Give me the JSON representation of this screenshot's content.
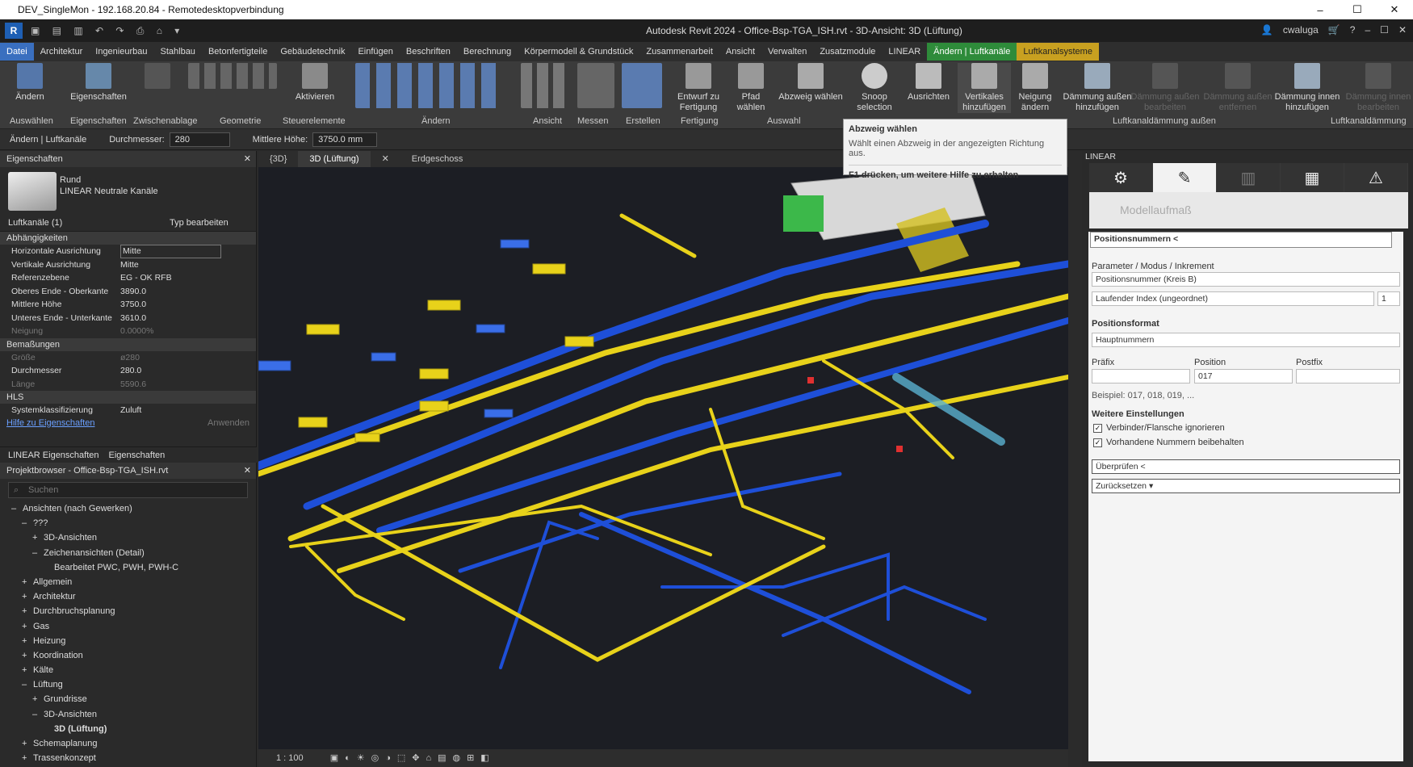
{
  "rdp": {
    "title": "DEV_SingleMon - 192.168.20.84 - Remotedesktopverbindung",
    "min": "–",
    "max": "☐",
    "close": "✕"
  },
  "title": {
    "text": "Autodesk Revit 2024 - Office-Bsp-TGA_ISH.rvt - 3D-Ansicht: 3D (Lüftung)",
    "user": "cwaluga"
  },
  "tabs": [
    "Datei",
    "Architektur",
    "Ingenieurbau",
    "Stahlbau",
    "Betonfertigteile",
    "Gebäudetechnik",
    "Einfügen",
    "Beschriften",
    "Berechnung",
    "Körpermodell & Grundstück",
    "Zusammenarbeit",
    "Ansicht",
    "Verwalten",
    "Zusatzmodule",
    "LINEAR",
    "Ändern | Luftkanäle",
    "Luftkanalsysteme"
  ],
  "ribbon": {
    "buttons": [
      "Ändern",
      "Eigenschaften",
      "Aktivieren",
      "Entwurf zu Fertigung",
      "Pfad wählen",
      "Abzweig wählen",
      "Snoop selection",
      "Ausrichten",
      "Vertikales hinzufügen",
      "Neigung ändern",
      "Dämmung außen hinzufügen",
      "Dämmung außen bearbeiten",
      "Dämmung außen entfernen",
      "Dämmung innen hinzufügen",
      "Dämmung innen bearbeiten"
    ],
    "groups": [
      "Auswählen",
      "Eigenschaften",
      "Zwischenablage",
      "Geometrie",
      "Steuerelemente",
      "Ändern",
      "Ansicht",
      "Messen",
      "Erstellen",
      "Fertigung",
      "Auswahl",
      "Luftkanaldämmung außen",
      "Luftkanaldämmung"
    ]
  },
  "optbar": {
    "context": "Ändern | Luftkanäle",
    "diam_label": "Durchmesser:",
    "diam_value": "280",
    "height_label": "Mittlere Höhe:",
    "height_value": "3750.0 mm"
  },
  "props": {
    "title": "Eigenschaften",
    "type_name": "Rund",
    "family": "LINEAR Neutrale Kanäle",
    "selector": "Luftkanäle (1)",
    "edit_type": "Typ bearbeiten",
    "sections": [
      {
        "name": "Abhängigkeiten",
        "rows": [
          [
            "Horizontale Ausrichtung",
            "Mitte"
          ],
          [
            "Vertikale Ausrichtung",
            "Mitte"
          ],
          [
            "Referenzebene",
            "EG - OK RFB"
          ],
          [
            "Oberes Ende - Oberkante",
            "3890.0"
          ],
          [
            "Mittlere Höhe",
            "3750.0"
          ],
          [
            "Unteres Ende - Unterkante",
            "3610.0"
          ],
          [
            "Neigung",
            "0.0000%"
          ]
        ]
      },
      {
        "name": "Bemaßungen",
        "rows": [
          [
            "Größe",
            "ø280"
          ],
          [
            "Durchmesser",
            "280.0"
          ],
          [
            "Länge",
            "5590.6"
          ]
        ]
      },
      {
        "name": "HLS",
        "rows": [
          [
            "Systemklassifizierung",
            "Zuluft"
          ]
        ]
      }
    ],
    "help": "Hilfe zu Eigenschaften",
    "apply": "Anwenden",
    "tab1": "LINEAR Eigenschaften",
    "tab2": "Eigenschaften"
  },
  "browser": {
    "title": "Projektbrowser - Office-Bsp-TGA_ISH.rvt",
    "search": "Suchen",
    "items": [
      {
        "t": "Ansichten (nach Gewerken)",
        "lvl": 0,
        "e": "–"
      },
      {
        "t": "???",
        "lvl": 1,
        "e": "–"
      },
      {
        "t": "3D-Ansichten",
        "lvl": 2,
        "e": "+"
      },
      {
        "t": "Zeichenansichten (Detail)",
        "lvl": 2,
        "e": "–"
      },
      {
        "t": "Bearbeitet PWC, PWH, PWH-C",
        "lvl": 3,
        "e": ""
      },
      {
        "t": "Allgemein",
        "lvl": 1,
        "e": "+"
      },
      {
        "t": "Architektur",
        "lvl": 1,
        "e": "+"
      },
      {
        "t": "Durchbruchsplanung",
        "lvl": 1,
        "e": "+"
      },
      {
        "t": "Gas",
        "lvl": 1,
        "e": "+"
      },
      {
        "t": "Heizung",
        "lvl": 1,
        "e": "+"
      },
      {
        "t": "Koordination",
        "lvl": 1,
        "e": "+"
      },
      {
        "t": "Kälte",
        "lvl": 1,
        "e": "+"
      },
      {
        "t": "Lüftung",
        "lvl": 1,
        "e": "–"
      },
      {
        "t": "Grundrisse",
        "lvl": 2,
        "e": "+"
      },
      {
        "t": "3D-Ansichten",
        "lvl": 2,
        "e": "–"
      },
      {
        "t": "3D (Lüftung)",
        "lvl": 3,
        "e": ""
      },
      {
        "t": "Schemaplanung",
        "lvl": 1,
        "e": "+"
      },
      {
        "t": "Trassenkonzept",
        "lvl": 1,
        "e": "+"
      }
    ]
  },
  "viewtabs": [
    "{3D}",
    "3D (Lüftung)",
    "Erdgeschoss"
  ],
  "scale": "1 : 100",
  "tooltip": {
    "title": "Abzweig wählen",
    "desc": "Wählt einen Abzweig in der angezeigten Richtung aus.",
    "help": "F1 drücken, um weitere Hilfe zu erhalten"
  },
  "linear": {
    "title": "LINEAR",
    "module": "Modellaufmaß",
    "panel_title": "Positionsnummern <",
    "param_label": "Parameter / Modus / Inkrement",
    "param_value": "Positionsnummer (Kreis B)",
    "mode_value": "Laufender Index (ungeordnet)",
    "increment": "1",
    "format_label": "Positionsformat",
    "format_value": "Hauptnummern",
    "prefix_label": "Präfix",
    "position_label": "Position",
    "postfix_label": "Postfix",
    "position_value": "017",
    "example": "Beispiel: 017, 018, 019, ...",
    "more_label": "Weitere Einstellungen",
    "cb1": "Verbinder/Flansche ignorieren",
    "cb2": "Vorhandene Nummern beibehalten",
    "check": "Überprüfen <",
    "reset": "Zurücksetzen ▾"
  },
  "colors": {
    "yellow": "#e8d21a",
    "blue": "#1e4fd8",
    "accent": "#3a6fbf"
  }
}
